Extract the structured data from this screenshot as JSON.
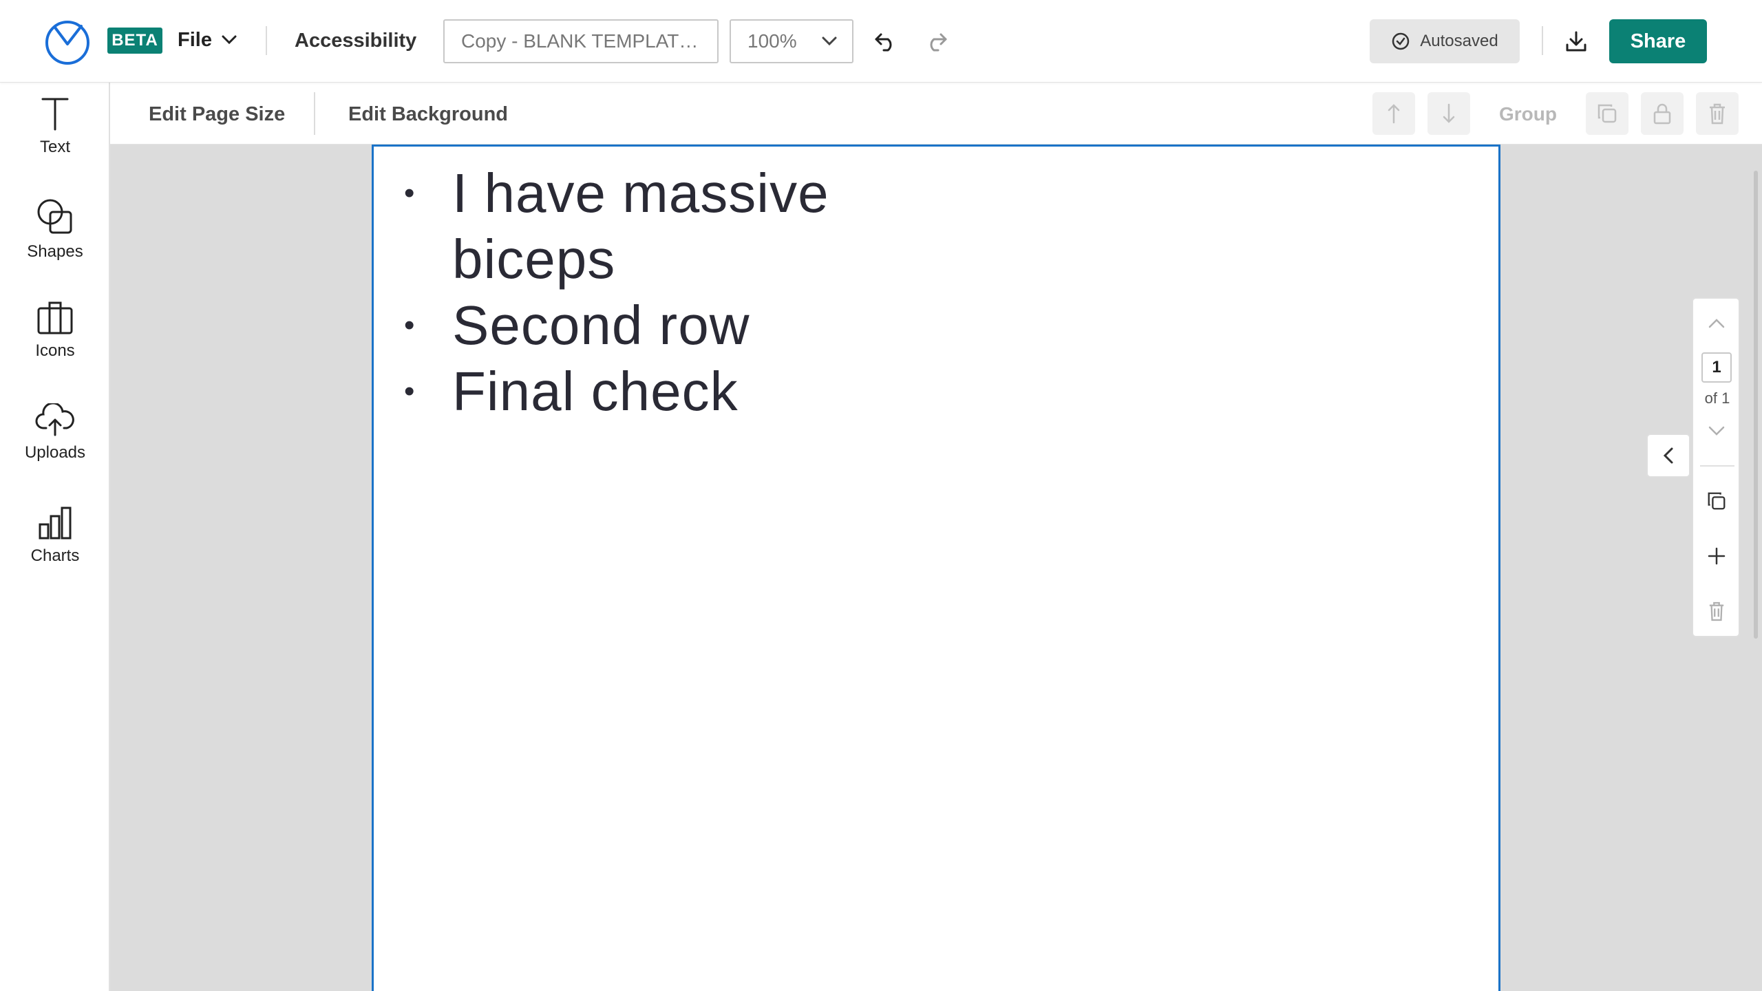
{
  "header": {
    "beta_label": "BETA",
    "file_label": "File",
    "accessibility_label": "Accessibility",
    "title_value": "Copy - BLANK TEMPLAT…",
    "zoom_value": "100%",
    "autosaved_label": "Autosaved",
    "share_label": "Share",
    "icons": [
      "logo-icon",
      "chevron-down-icon",
      "undo-icon",
      "redo-icon",
      "check-circle-icon",
      "download-icon"
    ]
  },
  "sidebar": {
    "items": [
      {
        "label": "Text",
        "icon": "text-icon"
      },
      {
        "label": "Shapes",
        "icon": "shapes-icon"
      },
      {
        "label": "Icons",
        "icon": "icons-icon"
      },
      {
        "label": "Uploads",
        "icon": "upload-cloud-icon"
      },
      {
        "label": "Charts",
        "icon": "bar-chart-icon"
      }
    ]
  },
  "subtoolbar": {
    "edit_page_size": "Edit Page Size",
    "edit_background": "Edit Background",
    "group_label": "Group",
    "icons": [
      "move-up-icon",
      "move-down-icon",
      "duplicate-icon",
      "lock-icon",
      "trash-icon"
    ]
  },
  "document": {
    "bullets": [
      "I have massive biceps",
      "Second row",
      "Final check"
    ]
  },
  "page_nav": {
    "current": "1",
    "of_label": "of 1"
  },
  "colors": {
    "brand": "#0b8174",
    "selection": "#1a73c8",
    "canvas_bg": "#dcdcdc"
  }
}
